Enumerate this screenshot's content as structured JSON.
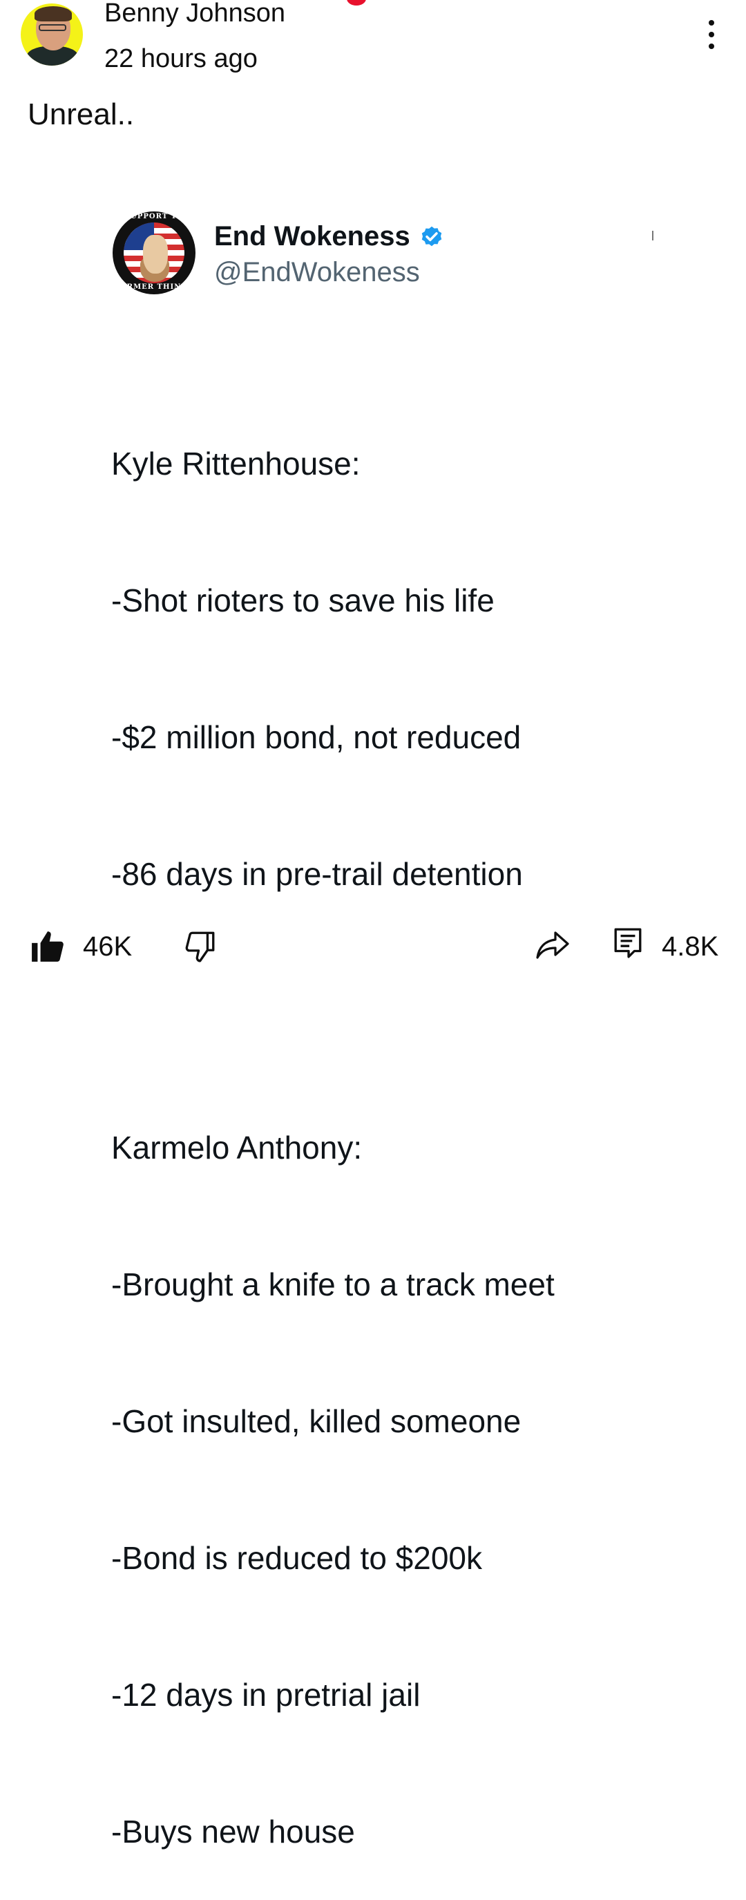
{
  "post": {
    "author": "Benny Johnson",
    "timestamp": "22 hours ago",
    "text": "Unreal..",
    "menu_icon": "more-vertical-icon"
  },
  "embed": {
    "name": "End Wokeness",
    "handle": "@EndWokeness",
    "verified": true,
    "avatar_text_top": "I SUPPORT THE",
    "avatar_text_bottom": "FORMER THINGS",
    "lines": [
      "Kyle Rittenhouse:",
      "-Shot rioters to save his life",
      "-$2 million bond, not reduced",
      "-86 days in pre-trail detention",
      "",
      "Karmelo Anthony:",
      "-Brought a knife to a track meet",
      "-Got insulted, killed someone",
      "-Bond is reduced to $200k",
      "-12 days in pretrial jail",
      "-Buys new house"
    ]
  },
  "actions": {
    "likes": "46K",
    "comments": "4.8K",
    "like_icon": "thumbs-up-icon",
    "dislike_icon": "thumbs-down-icon",
    "share_icon": "share-icon",
    "comment_icon": "comment-icon"
  },
  "colors": {
    "accent_verified": "#1d9bf0",
    "notification_dot": "#e8112d",
    "avatar_bg": "#f4f218"
  }
}
